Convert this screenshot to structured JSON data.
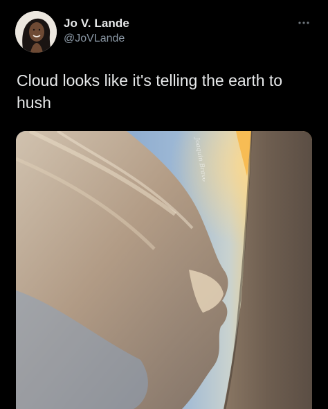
{
  "tweet": {
    "author": {
      "name": "Jo V. Lande",
      "handle": "@JoVLande"
    },
    "text": "Cloud looks like it's telling the earth to hush",
    "more_icon": "more-horizontal-icon",
    "media": {
      "type": "photo",
      "watermark": "Joaquin Bravo"
    }
  },
  "colors": {
    "background": "#000000",
    "name_text": "#e7e9ea",
    "handle_text": "#8b98a5",
    "sky_top": "#7a9dc7",
    "sunset_glow": "#f4c86a",
    "ground": "#6b5a4a"
  }
}
